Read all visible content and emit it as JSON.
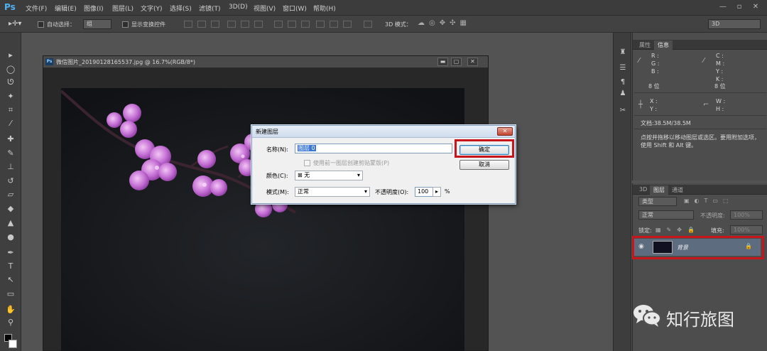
{
  "app": {
    "logo": "Ps"
  },
  "menu": [
    "文件(F)",
    "编辑(E)",
    "图像(I)",
    "图层(L)",
    "文字(Y)",
    "选择(S)",
    "滤镜(T)",
    "3D(D)",
    "视图(V)",
    "窗口(W)",
    "帮助(H)"
  ],
  "options_bar": {
    "auto_select_label": "自动选择：",
    "auto_select_value": "组",
    "show_transform_label": "显示变换控件",
    "mode_3d_label": "3D 模式：",
    "workspace_value": "3D"
  },
  "document": {
    "title": "微信图片_20190128165537.jpg @ 16.7%(RGB/8*)"
  },
  "dialog": {
    "title": "新建图层",
    "name_label": "名称(N):",
    "name_value": "图层 0",
    "clip_label": "使用前一图层创建剪贴蒙版(P)",
    "color_label": "颜色(C):",
    "color_value": "无",
    "mode_label": "模式(M):",
    "mode_value": "正常",
    "opacity_label": "不透明度(O):",
    "opacity_value": "100",
    "opacity_unit": "%",
    "ok_label": "确定",
    "cancel_label": "取消"
  },
  "info_panel": {
    "tabs": [
      "属性",
      "信息"
    ],
    "rgb_labels": [
      "R :",
      "G :",
      "B :"
    ],
    "cmyk_labels": [
      "C :",
      "M :",
      "Y :",
      "K :"
    ],
    "bit_depth_left": "8 位",
    "bit_depth_right": "8 位",
    "xy_labels": [
      "X :",
      "Y :"
    ],
    "wh_labels": [
      "W :",
      "H :"
    ],
    "doc_size": "文档:38.5M/38.5M",
    "hint": "点按并拖移以移动图层或选区。要用附加选项，使用 Shift 和 Alt 键。"
  },
  "layers_panel": {
    "tabs": [
      "3D",
      "图层",
      "通道"
    ],
    "filter_value": "类型",
    "blend_value": "正常",
    "opacity_label": "不透明度:",
    "opacity_value": "100%",
    "lock_label": "锁定:",
    "fill_label": "填充:",
    "fill_value": "100%",
    "layer_name": "背景"
  },
  "watermark": {
    "text": "知行旅图"
  },
  "colors": {
    "highlight": "#c8141b",
    "ps_blue": "#4fb2f5",
    "blossom": "#d58fe0"
  }
}
